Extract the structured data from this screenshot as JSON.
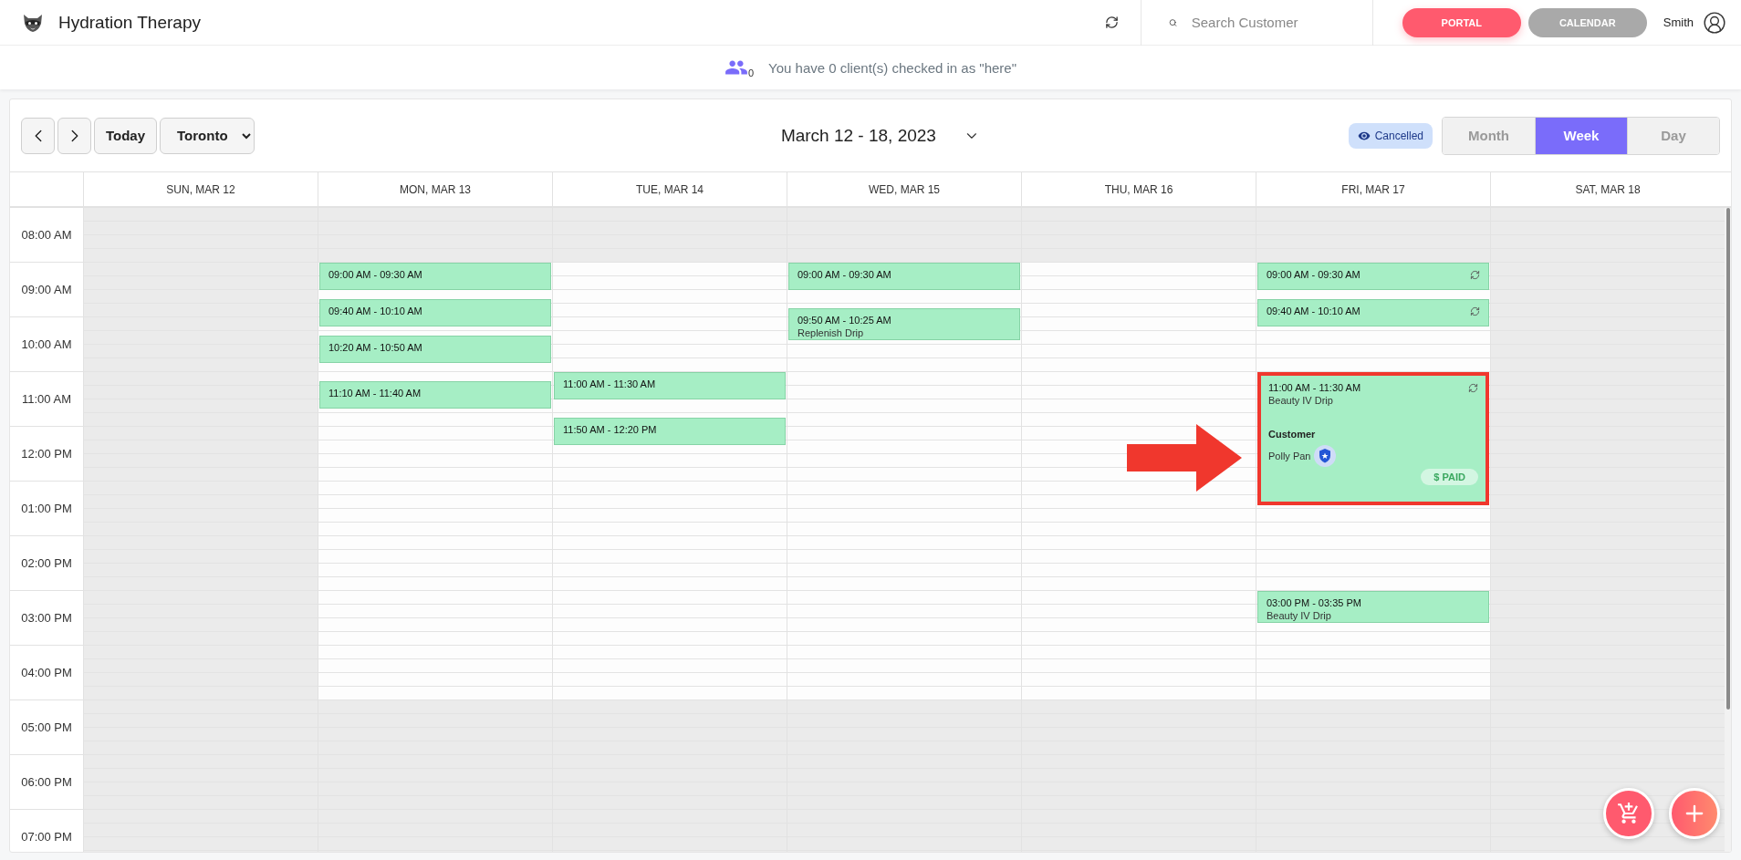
{
  "header": {
    "title": "Hydration Therapy",
    "search": {
      "placeholder": "Search Customer"
    },
    "buttons": [
      {
        "label": "PORTAL",
        "disabled": false
      },
      {
        "label": "CALENDAR",
        "disabled": true
      }
    ],
    "user": "Smith"
  },
  "checkin": {
    "count": "0",
    "message": "You have 0 client(s) checked in as \"here\""
  },
  "toolbar": {
    "today": "Today",
    "timezone": "Toronto",
    "range": "March 12 - 18, 2023",
    "filter": "Cancelled",
    "views": [
      {
        "label": "Month",
        "selected": false
      },
      {
        "label": "Week",
        "selected": true
      },
      {
        "label": "Day",
        "selected": false
      }
    ]
  },
  "calendar": {
    "hours": [
      "08:00 AM",
      "09:00 AM",
      "10:00 AM",
      "11:00 AM",
      "12:00 PM",
      "01:00 PM",
      "02:00 PM",
      "03:00 PM",
      "04:00 PM",
      "05:00 PM",
      "06:00 PM",
      "07:00 PM"
    ],
    "days": [
      {
        "label": "SUN, MAR 12",
        "open": false
      },
      {
        "label": "MON, MAR 13",
        "open": true,
        "events": [
          {
            "time": "09:00 AM - 09:30 AM",
            "recurring": false,
            "expanded": false,
            "highlighted": false
          },
          {
            "time": "09:40 AM - 10:10 AM",
            "recurring": false,
            "expanded": false,
            "highlighted": false
          },
          {
            "time": "10:20 AM - 10:50 AM",
            "recurring": false,
            "expanded": false,
            "highlighted": false
          },
          {
            "time": "11:10 AM - 11:40 AM",
            "recurring": false,
            "expanded": false,
            "highlighted": false
          }
        ]
      },
      {
        "label": "TUE, MAR 14",
        "open": true,
        "events": [
          {
            "time": "11:00 AM - 11:30 AM",
            "recurring": false,
            "expanded": false,
            "highlighted": false
          },
          {
            "time": "11:50 AM - 12:20 PM",
            "recurring": false,
            "expanded": false,
            "highlighted": false
          }
        ]
      },
      {
        "label": "WED, MAR 15",
        "open": true,
        "events": [
          {
            "time": "09:00 AM - 09:30 AM",
            "recurring": false,
            "expanded": false,
            "highlighted": false
          },
          {
            "time": "09:50 AM - 10:25 AM",
            "title": "Replenish Drip",
            "recurring": false,
            "expanded": false,
            "highlighted": false
          }
        ]
      },
      {
        "label": "THU, MAR 16",
        "open": true
      },
      {
        "label": "FRI, MAR 17",
        "open": true,
        "events": [
          {
            "time": "09:00 AM - 09:30 AM",
            "recurring": true,
            "expanded": false,
            "highlighted": false
          },
          {
            "time": "09:40 AM - 10:10 AM",
            "recurring": true,
            "expanded": false,
            "highlighted": false
          },
          {
            "time": "11:00 AM - 11:30 AM",
            "title": "Beauty IV Drip",
            "recurring": true,
            "expanded": true,
            "highlighted": true,
            "customer_label": "Customer",
            "customer": "Polly Pan",
            "payment": "$ PAID"
          },
          {
            "time": "03:00 PM - 03:35 PM",
            "title": "Beauty IV Drip",
            "recurring": false,
            "expanded": false,
            "highlighted": false
          }
        ]
      },
      {
        "label": "SAT, MAR 18",
        "open": false
      }
    ]
  }
}
